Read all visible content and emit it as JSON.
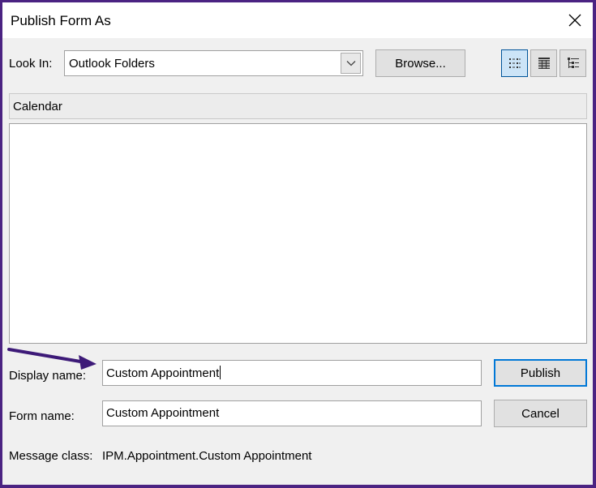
{
  "dialog": {
    "title": "Publish Form As",
    "close_icon": "close-icon"
  },
  "look_in": {
    "label": "Look In:",
    "value": "Outlook Folders"
  },
  "toolbar": {
    "browse_label": "Browse...",
    "view_buttons": [
      "list-view-icon",
      "details-view-icon",
      "tree-view-icon"
    ]
  },
  "folder": {
    "current": "Calendar"
  },
  "fields": {
    "display_name_label": "Display name:",
    "display_name_value": "Custom Appointment",
    "form_name_label": "Form name:",
    "form_name_value": "Custom Appointment",
    "message_class_label": "Message class:",
    "message_class_value": "IPM.Appointment.Custom Appointment"
  },
  "actions": {
    "publish_label": "Publish",
    "cancel_label": "Cancel"
  },
  "colors": {
    "accent": "#0078d7",
    "annotation_arrow": "#3d1a78",
    "frame": "#4b2382"
  }
}
